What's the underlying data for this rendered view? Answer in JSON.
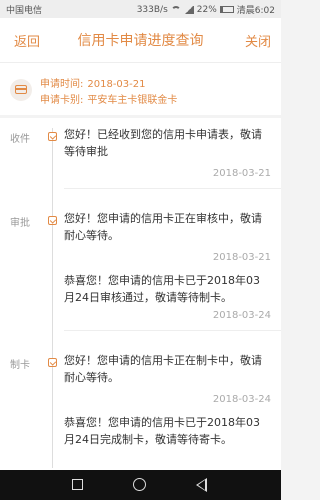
{
  "status_bar": {
    "carrier": "中国电信",
    "speed": "333B/s",
    "battery": "22%",
    "time": "清晨6:02"
  },
  "header": {
    "back": "返回",
    "title": "信用卡申请进度查询",
    "close": "关闭"
  },
  "info": {
    "apply_time_label": "申请时间:",
    "apply_time": "2018-03-21",
    "card_type_label": "申请卡别:",
    "card_type": "平安车主卡银联金卡"
  },
  "timeline": {
    "stages": [
      "收件",
      "审批",
      "制卡"
    ],
    "events": [
      {
        "text": "您好！已经收到您的信用卡申请表，敬请等待审批",
        "date": "2018-03-21"
      },
      {
        "text": "您好！您申请的信用卡正在审核中，敬请耐心等待。",
        "date": "2018-03-21"
      },
      {
        "text": "恭喜您！您申请的信用卡已于2018年03月24日审核通过，敬请等待制卡。",
        "date": "2018-03-24"
      },
      {
        "text": "您好！您申请的信用卡正在制卡中，敬请耐心等待。",
        "date": "2018-03-24"
      },
      {
        "text": "恭喜您！您申请的信用卡已于2018年03月24日完成制卡，敬请等待寄卡。",
        "date": ""
      }
    ]
  },
  "navbar": {
    "icons": [
      "recent-apps-icon",
      "home-icon",
      "back-icon"
    ]
  }
}
